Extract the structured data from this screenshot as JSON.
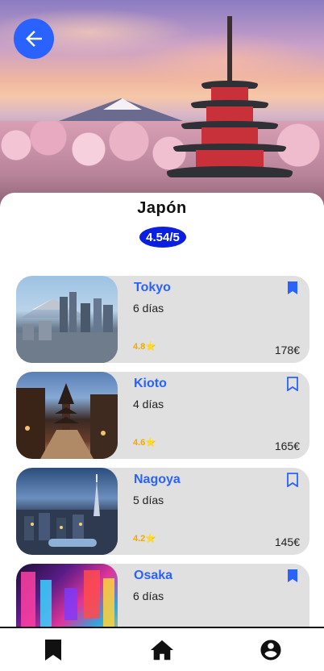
{
  "header": {
    "back_icon": "arrow-left-icon",
    "accent_color": "#2962ff"
  },
  "country": {
    "name": "Japón",
    "rating": "4.54/5"
  },
  "cities": [
    {
      "name": "Tokyo",
      "days": "6 días",
      "rating": "4.8",
      "price": "178€",
      "bookmarked": true
    },
    {
      "name": "Kioto",
      "days": "4 días",
      "rating": "4.6",
      "price": "165€",
      "bookmarked": false
    },
    {
      "name": "Nagoya",
      "days": "5 días",
      "rating": "4.2",
      "price": "145€",
      "bookmarked": false
    },
    {
      "name": "Osaka",
      "days": "6 días",
      "rating": "",
      "price": "",
      "bookmarked": true
    }
  ],
  "star_glyph": "⭐",
  "tabbar": {
    "items": [
      {
        "icon": "bookmark-icon"
      },
      {
        "icon": "home-icon"
      },
      {
        "icon": "account-icon"
      }
    ]
  }
}
